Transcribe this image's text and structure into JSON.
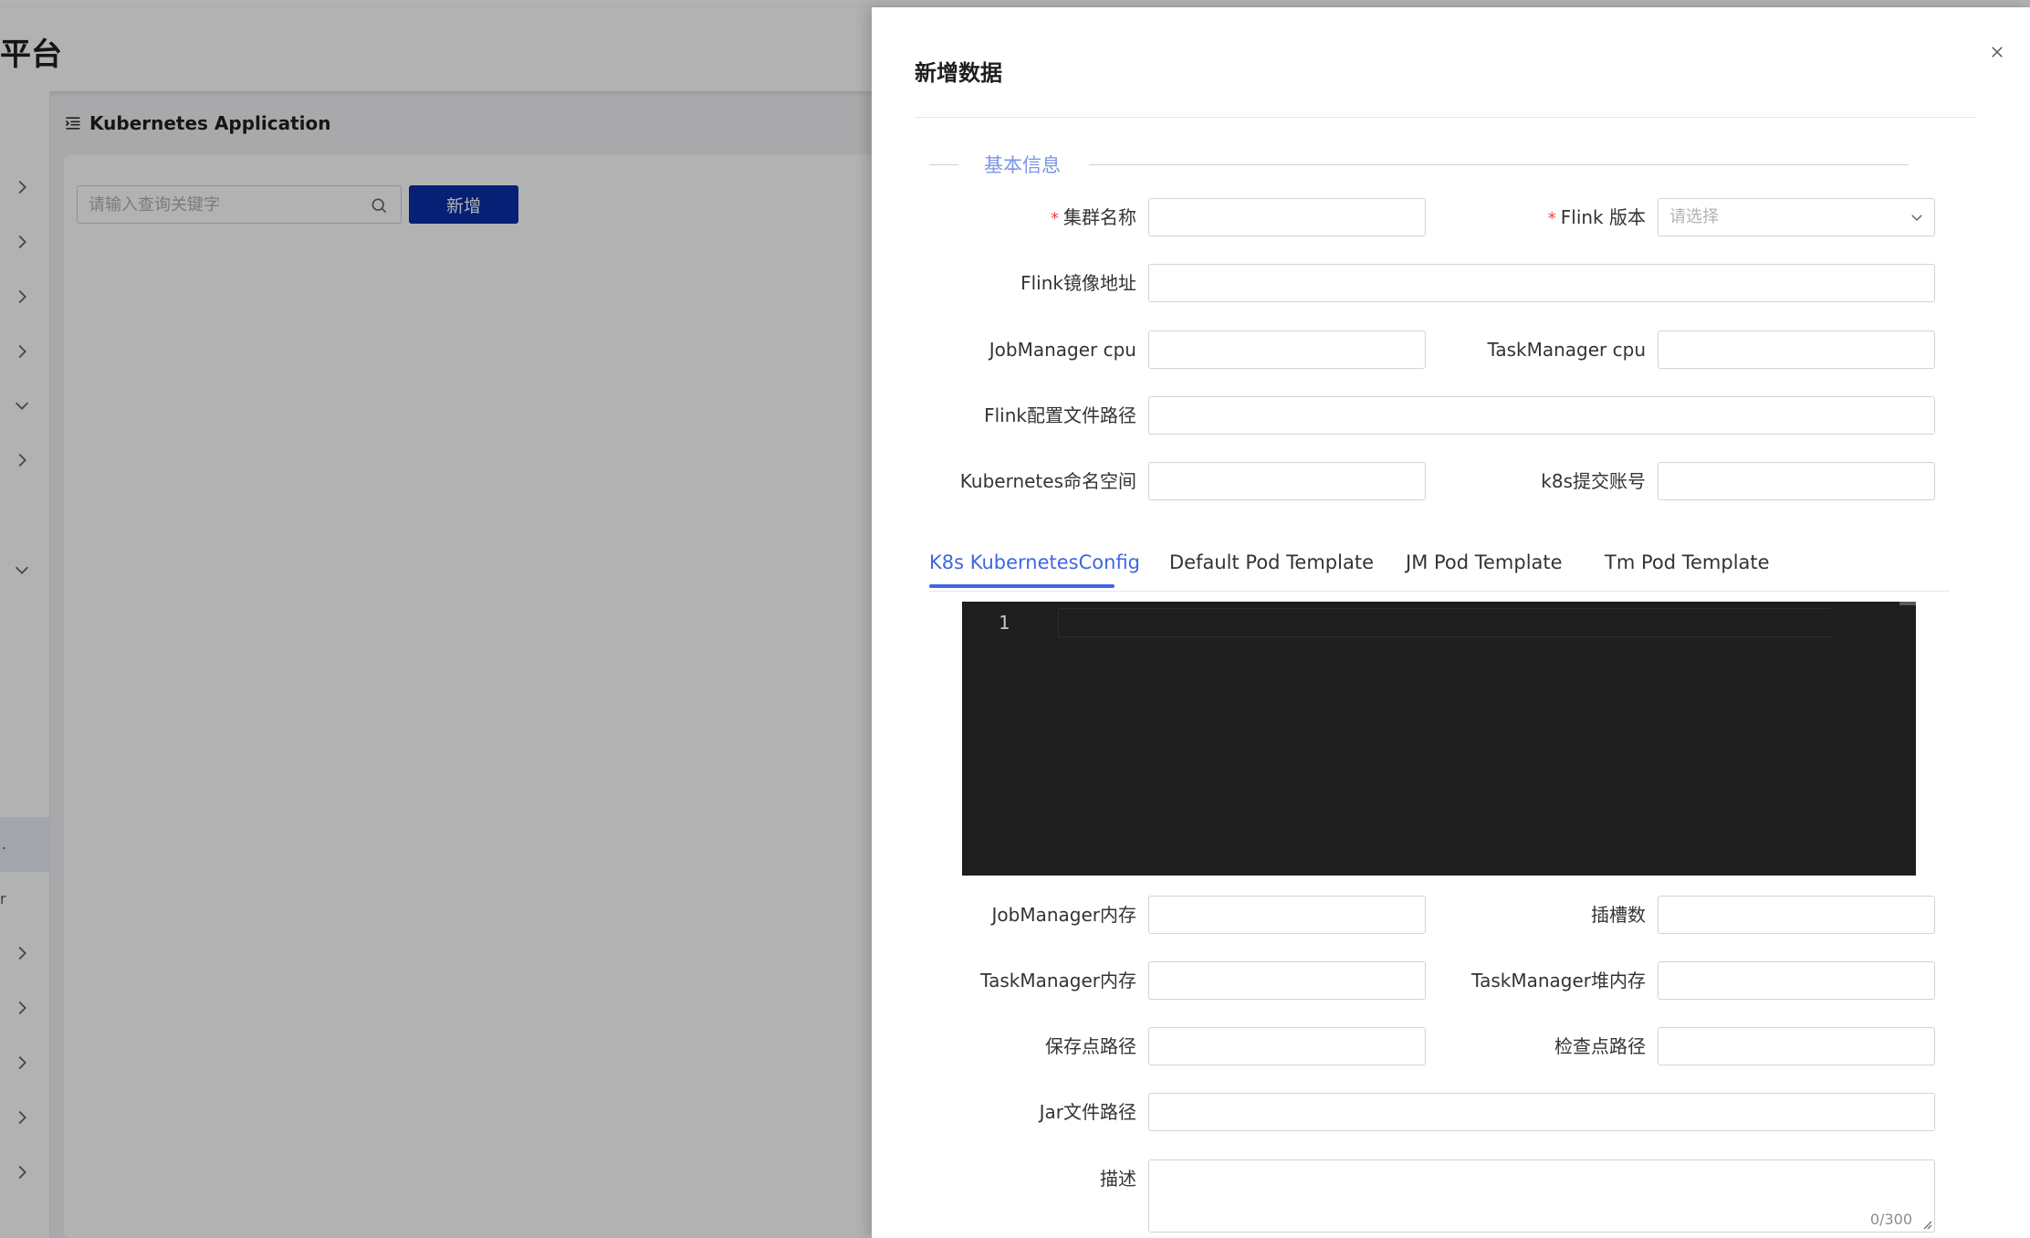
{
  "background": {
    "app_title": "平台",
    "breadcrumb": "Kubernetes Application",
    "search_placeholder": "请输入查询关键字",
    "add_button": "新增",
    "sidebar_active_text": ".",
    "sidebar_text_r": "r",
    "brand_color": "#0a2fa8"
  },
  "drawer": {
    "title": "新增数据",
    "section_title": "基本信息",
    "required_mark": "*",
    "fields": {
      "cluster_name": "集群名称",
      "flink_version": "Flink 版本",
      "flink_version_placeholder": "请选择",
      "flink_image": "Flink镜像地址",
      "jm_cpu": "JobManager cpu",
      "tm_cpu": "TaskManager cpu",
      "flink_conf_path": "Flink配置文件路径",
      "k8s_namespace": "Kubernetes命名空间",
      "k8s_account": "k8s提交账号",
      "jm_memory": "JobManager内存",
      "slots": "插槽数",
      "tm_memory": "TaskManager内存",
      "tm_heap": "TaskManager堆内存",
      "savepoint_path": "保存点路径",
      "checkpoint_path": "检查点路径",
      "jar_path": "Jar文件路径",
      "description": "描述",
      "description_count": "0/300"
    },
    "tabs": [
      "K8s KubernetesConfig",
      "Default Pod Template",
      "JM Pod Template",
      "Tm Pod Template"
    ],
    "active_tab_color": "#4066e0",
    "editor": {
      "line_number": "1",
      "content": ""
    }
  }
}
